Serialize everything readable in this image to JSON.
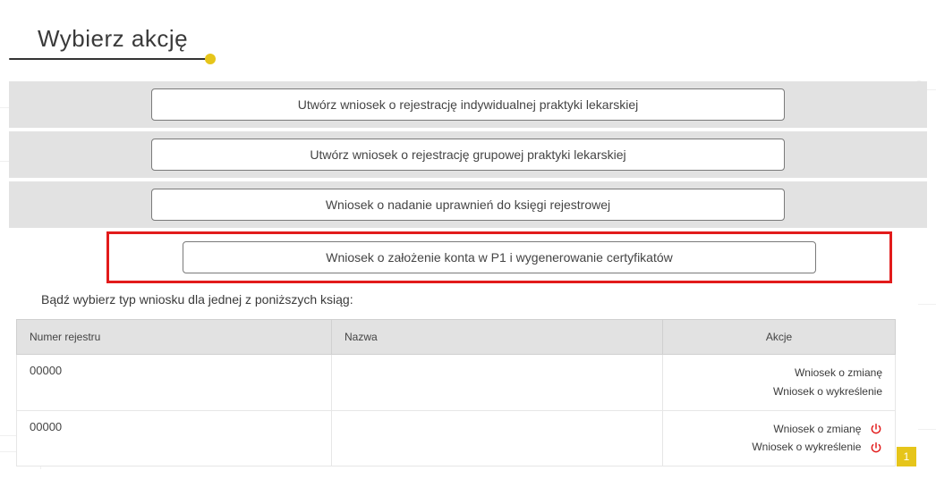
{
  "title": "Wybierz akcję",
  "actions": [
    "Utwórz wniosek o rejestrację indywidualnej praktyki lekarskiej",
    "Utwórz wniosek o rejestrację grupowej praktyki lekarskiej",
    "Wniosek o nadanie uprawnień do księgi rejestrowej",
    "Wniosek o założenie konta w P1 i wygenerowanie certyfikatów"
  ],
  "subtext": "Bądź wybierz typ wniosku dla jednej z poniższych ksiąg:",
  "table": {
    "headers": {
      "number": "Numer rejestru",
      "name": "Nazwa",
      "actions": "Akcje"
    },
    "rows": [
      {
        "number": "00000",
        "name": "",
        "show_icons": false
      },
      {
        "number": "00000",
        "name": "",
        "show_icons": true
      }
    ],
    "action_links": {
      "change": "Wniosek o zmianę",
      "delete": "Wniosek o wykreślenie"
    }
  },
  "pager": {
    "current": "1"
  }
}
